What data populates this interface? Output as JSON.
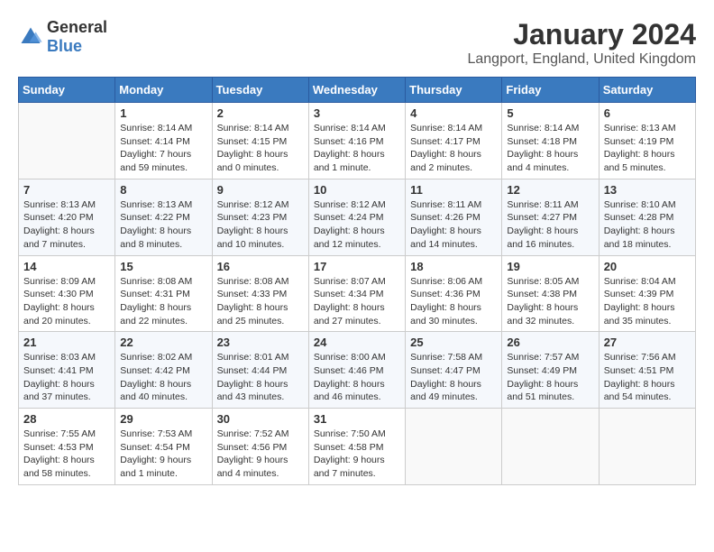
{
  "logo": {
    "general": "General",
    "blue": "Blue"
  },
  "title": "January 2024",
  "location": "Langport, England, United Kingdom",
  "weekdays": [
    "Sunday",
    "Monday",
    "Tuesday",
    "Wednesday",
    "Thursday",
    "Friday",
    "Saturday"
  ],
  "weeks": [
    [
      {
        "day": "",
        "info": ""
      },
      {
        "day": "1",
        "info": "Sunrise: 8:14 AM\nSunset: 4:14 PM\nDaylight: 7 hours\nand 59 minutes."
      },
      {
        "day": "2",
        "info": "Sunrise: 8:14 AM\nSunset: 4:15 PM\nDaylight: 8 hours\nand 0 minutes."
      },
      {
        "day": "3",
        "info": "Sunrise: 8:14 AM\nSunset: 4:16 PM\nDaylight: 8 hours\nand 1 minute."
      },
      {
        "day": "4",
        "info": "Sunrise: 8:14 AM\nSunset: 4:17 PM\nDaylight: 8 hours\nand 2 minutes."
      },
      {
        "day": "5",
        "info": "Sunrise: 8:14 AM\nSunset: 4:18 PM\nDaylight: 8 hours\nand 4 minutes."
      },
      {
        "day": "6",
        "info": "Sunrise: 8:13 AM\nSunset: 4:19 PM\nDaylight: 8 hours\nand 5 minutes."
      }
    ],
    [
      {
        "day": "7",
        "info": "Sunrise: 8:13 AM\nSunset: 4:20 PM\nDaylight: 8 hours\nand 7 minutes."
      },
      {
        "day": "8",
        "info": "Sunrise: 8:13 AM\nSunset: 4:22 PM\nDaylight: 8 hours\nand 8 minutes."
      },
      {
        "day": "9",
        "info": "Sunrise: 8:12 AM\nSunset: 4:23 PM\nDaylight: 8 hours\nand 10 minutes."
      },
      {
        "day": "10",
        "info": "Sunrise: 8:12 AM\nSunset: 4:24 PM\nDaylight: 8 hours\nand 12 minutes."
      },
      {
        "day": "11",
        "info": "Sunrise: 8:11 AM\nSunset: 4:26 PM\nDaylight: 8 hours\nand 14 minutes."
      },
      {
        "day": "12",
        "info": "Sunrise: 8:11 AM\nSunset: 4:27 PM\nDaylight: 8 hours\nand 16 minutes."
      },
      {
        "day": "13",
        "info": "Sunrise: 8:10 AM\nSunset: 4:28 PM\nDaylight: 8 hours\nand 18 minutes."
      }
    ],
    [
      {
        "day": "14",
        "info": "Sunrise: 8:09 AM\nSunset: 4:30 PM\nDaylight: 8 hours\nand 20 minutes."
      },
      {
        "day": "15",
        "info": "Sunrise: 8:08 AM\nSunset: 4:31 PM\nDaylight: 8 hours\nand 22 minutes."
      },
      {
        "day": "16",
        "info": "Sunrise: 8:08 AM\nSunset: 4:33 PM\nDaylight: 8 hours\nand 25 minutes."
      },
      {
        "day": "17",
        "info": "Sunrise: 8:07 AM\nSunset: 4:34 PM\nDaylight: 8 hours\nand 27 minutes."
      },
      {
        "day": "18",
        "info": "Sunrise: 8:06 AM\nSunset: 4:36 PM\nDaylight: 8 hours\nand 30 minutes."
      },
      {
        "day": "19",
        "info": "Sunrise: 8:05 AM\nSunset: 4:38 PM\nDaylight: 8 hours\nand 32 minutes."
      },
      {
        "day": "20",
        "info": "Sunrise: 8:04 AM\nSunset: 4:39 PM\nDaylight: 8 hours\nand 35 minutes."
      }
    ],
    [
      {
        "day": "21",
        "info": "Sunrise: 8:03 AM\nSunset: 4:41 PM\nDaylight: 8 hours\nand 37 minutes."
      },
      {
        "day": "22",
        "info": "Sunrise: 8:02 AM\nSunset: 4:42 PM\nDaylight: 8 hours\nand 40 minutes."
      },
      {
        "day": "23",
        "info": "Sunrise: 8:01 AM\nSunset: 4:44 PM\nDaylight: 8 hours\nand 43 minutes."
      },
      {
        "day": "24",
        "info": "Sunrise: 8:00 AM\nSunset: 4:46 PM\nDaylight: 8 hours\nand 46 minutes."
      },
      {
        "day": "25",
        "info": "Sunrise: 7:58 AM\nSunset: 4:47 PM\nDaylight: 8 hours\nand 49 minutes."
      },
      {
        "day": "26",
        "info": "Sunrise: 7:57 AM\nSunset: 4:49 PM\nDaylight: 8 hours\nand 51 minutes."
      },
      {
        "day": "27",
        "info": "Sunrise: 7:56 AM\nSunset: 4:51 PM\nDaylight: 8 hours\nand 54 minutes."
      }
    ],
    [
      {
        "day": "28",
        "info": "Sunrise: 7:55 AM\nSunset: 4:53 PM\nDaylight: 8 hours\nand 58 minutes."
      },
      {
        "day": "29",
        "info": "Sunrise: 7:53 AM\nSunset: 4:54 PM\nDaylight: 9 hours\nand 1 minute."
      },
      {
        "day": "30",
        "info": "Sunrise: 7:52 AM\nSunset: 4:56 PM\nDaylight: 9 hours\nand 4 minutes."
      },
      {
        "day": "31",
        "info": "Sunrise: 7:50 AM\nSunset: 4:58 PM\nDaylight: 9 hours\nand 7 minutes."
      },
      {
        "day": "",
        "info": ""
      },
      {
        "day": "",
        "info": ""
      },
      {
        "day": "",
        "info": ""
      }
    ]
  ]
}
